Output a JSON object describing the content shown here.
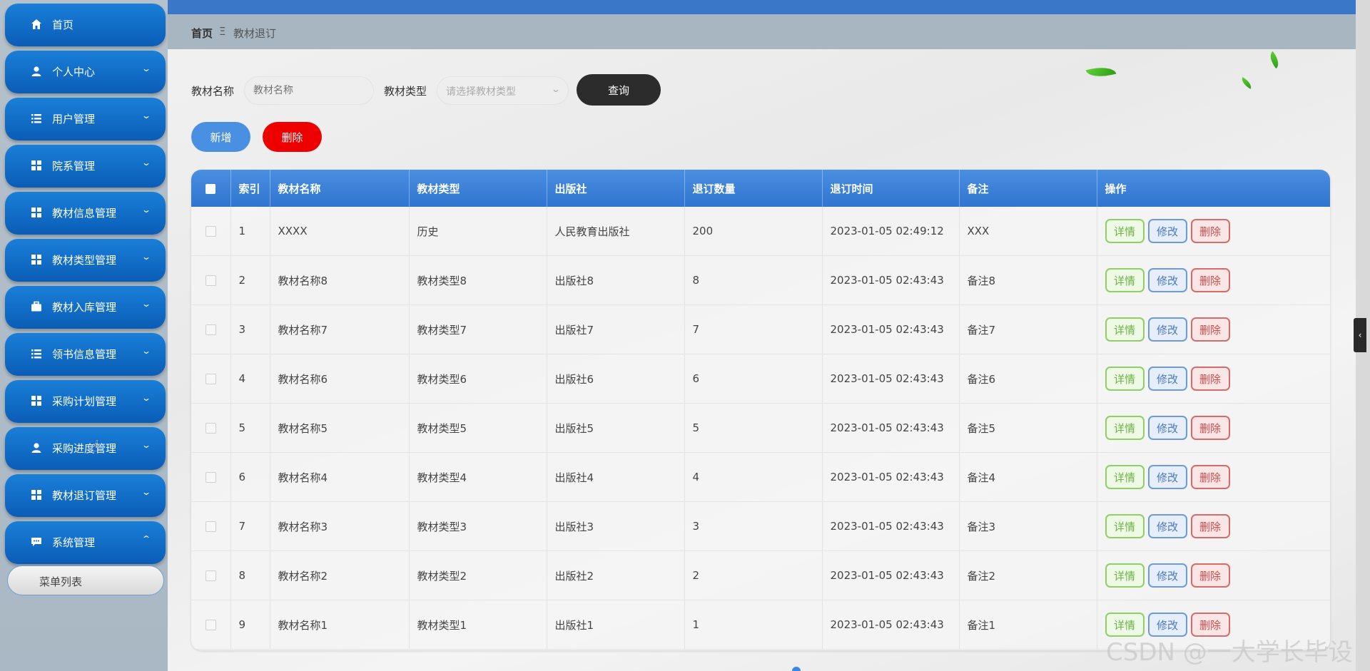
{
  "sidebar": {
    "items": [
      {
        "label": "首页",
        "icon": "home-icon",
        "has_arrow": false
      },
      {
        "label": "个人中心",
        "icon": "user-icon",
        "has_arrow": true
      },
      {
        "label": "用户管理",
        "icon": "list-icon",
        "has_arrow": true
      },
      {
        "label": "院系管理",
        "icon": "grid-icon",
        "has_arrow": true
      },
      {
        "label": "教材信息管理",
        "icon": "grid-icon",
        "has_arrow": true
      },
      {
        "label": "教材类型管理",
        "icon": "grid-icon",
        "has_arrow": true
      },
      {
        "label": "教材入库管理",
        "icon": "briefcase-icon",
        "has_arrow": true
      },
      {
        "label": "领书信息管理",
        "icon": "list-icon",
        "has_arrow": true
      },
      {
        "label": "采购计划管理",
        "icon": "grid-icon",
        "has_arrow": true
      },
      {
        "label": "采购进度管理",
        "icon": "user-icon",
        "has_arrow": true
      },
      {
        "label": "教材退订管理",
        "icon": "grid-icon",
        "has_arrow": true
      },
      {
        "label": "系统管理",
        "icon": "chat-icon",
        "has_arrow": true,
        "expanded": true
      }
    ],
    "sub_item": "菜单列表"
  },
  "breadcrumb": {
    "home": "首页",
    "separator": "Ξ",
    "current": "教材退订"
  },
  "search": {
    "name_label": "教材名称",
    "name_placeholder": "教材名称",
    "type_label": "教材类型",
    "type_placeholder": "请选择教材类型",
    "query_button": "查询"
  },
  "actions": {
    "add": "新增",
    "delete": "删除"
  },
  "table": {
    "headers": [
      "索引",
      "教材名称",
      "教材类型",
      "出版社",
      "退订数量",
      "退订时间",
      "备注",
      "操作"
    ],
    "rows": [
      [
        "1",
        "XXXX",
        "历史",
        "人民教育出版社",
        "200",
        "2023-01-05 02:49:12",
        "XXX"
      ],
      [
        "2",
        "教材名称8",
        "教材类型8",
        "出版社8",
        "8",
        "2023-01-05 02:43:43",
        "备注8"
      ],
      [
        "3",
        "教材名称7",
        "教材类型7",
        "出版社7",
        "7",
        "2023-01-05 02:43:43",
        "备注7"
      ],
      [
        "4",
        "教材名称6",
        "教材类型6",
        "出版社6",
        "6",
        "2023-01-05 02:43:43",
        "备注6"
      ],
      [
        "5",
        "教材名称5",
        "教材类型5",
        "出版社5",
        "5",
        "2023-01-05 02:43:43",
        "备注5"
      ],
      [
        "6",
        "教材名称4",
        "教材类型4",
        "出版社4",
        "4",
        "2023-01-05 02:43:43",
        "备注4"
      ],
      [
        "7",
        "教材名称3",
        "教材类型3",
        "出版社3",
        "3",
        "2023-01-05 02:43:43",
        "备注3"
      ],
      [
        "8",
        "教材名称2",
        "教材类型2",
        "出版社2",
        "2",
        "2023-01-05 02:43:43",
        "备注2"
      ],
      [
        "9",
        "教材名称1",
        "教材类型1",
        "出版社1",
        "1",
        "2023-01-05 02:43:43",
        "备注1"
      ]
    ],
    "row_actions": {
      "detail": "详情",
      "edit": "修改",
      "delete": "删除"
    }
  },
  "watermark": "CSDN @一大学长毕设",
  "colors": {
    "sidebar_item": "#0a6bc9",
    "topbar": "#3b77c9",
    "table_header": "#3a80d8",
    "query_button": "#2c2c2c",
    "add_button": "#4a90e2",
    "delete_button": "#ee0000"
  }
}
